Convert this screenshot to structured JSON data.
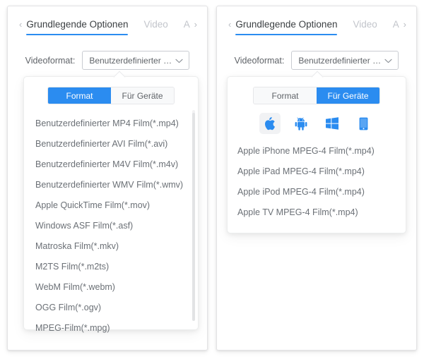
{
  "panels": [
    {
      "id": "left",
      "nav": {
        "prev_icon": "chevron-left-icon",
        "next_icon": "chevron-right-icon"
      },
      "tabs": [
        {
          "label": "Grundlegende Optionen",
          "active": true
        },
        {
          "label": "Video",
          "active": false
        },
        {
          "label": "Auc",
          "active": false
        }
      ],
      "format_row": {
        "label": "Videoformat:",
        "value": "Benutzerdefinierter M...",
        "chevron_icon": "chevron-down-icon"
      },
      "segmented": [
        {
          "label": "Format",
          "active": true
        },
        {
          "label": "Für Geräte",
          "active": false
        }
      ],
      "items": [
        "Benutzerdefinierter MP4 Film(*.mp4)",
        "Benutzerdefinierter AVI Film(*.avi)",
        "Benutzerdefinierter M4V Film(*.m4v)",
        "Benutzerdefinierter WMV Film(*.wmv)",
        "Apple QuickTime Film(*.mov)",
        "Windows ASF Film(*.asf)",
        "Matroska Film(*.mkv)",
        "M2TS Film(*.m2ts)",
        "WebM Film(*.webm)",
        "OGG Film(*.ogv)",
        "MPEG-Film(*.mpg)"
      ]
    },
    {
      "id": "right",
      "nav": {
        "prev_icon": "chevron-left-icon",
        "next_icon": "chevron-right-icon"
      },
      "tabs": [
        {
          "label": "Grundlegende Optionen",
          "active": true
        },
        {
          "label": "Video",
          "active": false
        },
        {
          "label": "Auc",
          "active": false
        }
      ],
      "format_row": {
        "label": "Videoformat:",
        "value": "Benutzerdefinierter M...",
        "chevron_icon": "chevron-down-icon"
      },
      "segmented": [
        {
          "label": "Format",
          "active": false
        },
        {
          "label": "Für Geräte",
          "active": true
        }
      ],
      "devices": [
        {
          "icon": "apple-icon",
          "selected": true
        },
        {
          "icon": "android-icon",
          "selected": false
        },
        {
          "icon": "windows-icon",
          "selected": false
        },
        {
          "icon": "mobile-phone-icon",
          "selected": false
        }
      ],
      "items": [
        "Apple iPhone MPEG-4 Film(*.mp4)",
        "Apple iPad MPEG-4 Film(*.mp4)",
        "Apple iPod MPEG-4 Film(*.mp4)",
        "Apple TV MPEG-4 Film(*.mp4)"
      ]
    }
  ],
  "colors": {
    "accent": "#2b8cf0",
    "text": "#6b7076",
    "tab_active_text": "#3c4043",
    "tab_inactive_text": "#c2c5cb",
    "panel_border": "#e3e3e5",
    "selected_device_bg": "#f1f2f4"
  }
}
